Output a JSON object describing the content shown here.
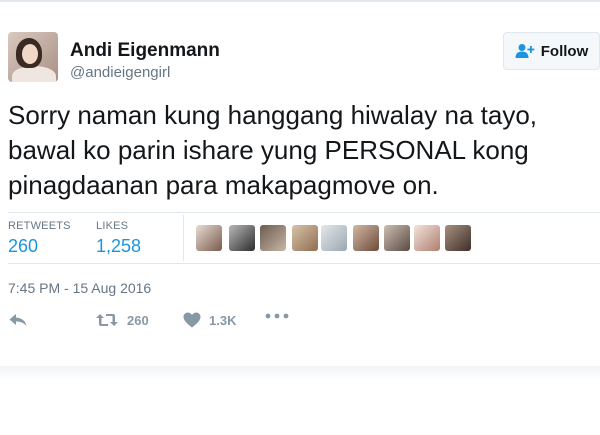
{
  "author": {
    "display_name": "Andi Eigenmann",
    "username": "@andieigengirl"
  },
  "follow_button": {
    "label": "Follow"
  },
  "tweet": {
    "text_lines": [
      "Sorry naman kung hanggang hiwalay na tayo,",
      "bawal ko parin ishare yung PERSONAL kong",
      "pinagdaanan para makapagmove on."
    ],
    "timestamp": "7:45 PM - 15 Aug 2016"
  },
  "stats": {
    "retweets_label": "RETWEETS",
    "retweets_count": "260",
    "likes_label": "LIKES",
    "likes_count": "1,258"
  },
  "actions": {
    "reply_icon": "reply-icon",
    "retweet_icon": "retweet-icon",
    "retweet_count": "260",
    "like_icon": "heart-icon",
    "like_count": "1.3K",
    "more_icon": "more-icon"
  },
  "colors": {
    "link_blue": "#1b95e0",
    "muted": "#657786",
    "icon_gray": "#8899a6"
  }
}
